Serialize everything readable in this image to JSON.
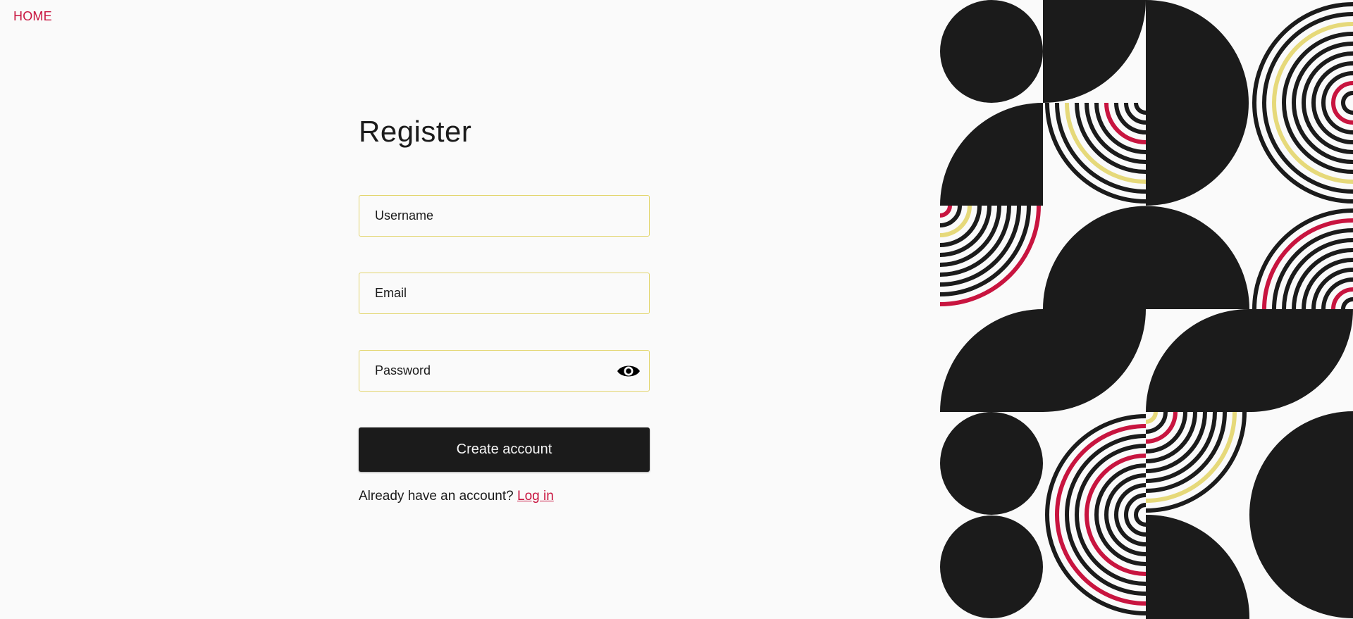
{
  "nav": {
    "home_label": "HOME"
  },
  "form": {
    "title": "Register",
    "username_placeholder": "Username",
    "email_placeholder": "Email",
    "password_placeholder": "Password",
    "submit_label": "Create account",
    "login_prompt": "Already have an account? ",
    "login_link": "Log in"
  },
  "icons": {
    "password_toggle": "eye-icon"
  },
  "colors": {
    "accent": "#c8143f",
    "field_border": "#e2d56d",
    "dark": "#1b1b1b",
    "yellow": "#e6d97a",
    "background": "#fafafa"
  }
}
